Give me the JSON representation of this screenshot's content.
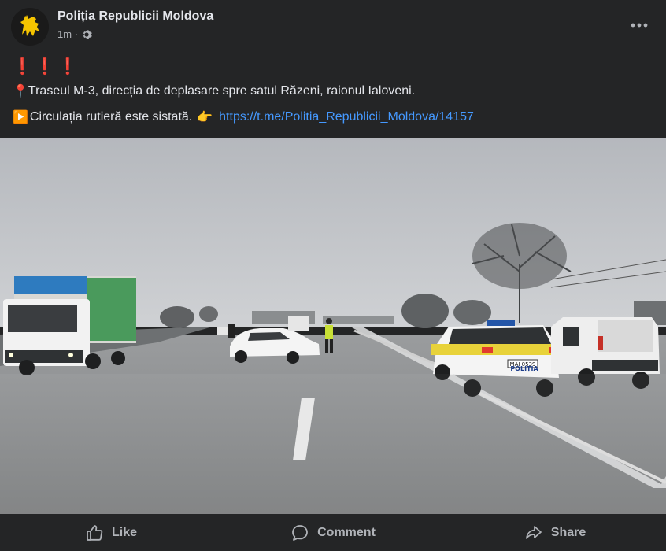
{
  "post": {
    "page_name": "Poliția Republicii Moldova",
    "time": "1m",
    "separator": "·",
    "alert_marks": "❗❗❗",
    "location_icon": "📍",
    "location_text": "Traseul M-3, direcția de deplasare spre satul Răzeni, raionul Ialoveni.",
    "play_icon": "▶️",
    "traffic_text": "Circulația rutieră este sistată.",
    "pointing_icon": "👉",
    "link": "https://t.me/Politia_Republicii_Moldova/14157"
  },
  "photo": {
    "police_car_label": "POLIȚIA",
    "plate": "MAI 0539"
  },
  "actions": {
    "like": "Like",
    "comment": "Comment",
    "share": "Share"
  },
  "colors": {
    "background": "#242526",
    "text": "#e4e6eb",
    "secondary_text": "#b0b3b8",
    "link": "#4599ff",
    "alert": "#e0322b"
  }
}
